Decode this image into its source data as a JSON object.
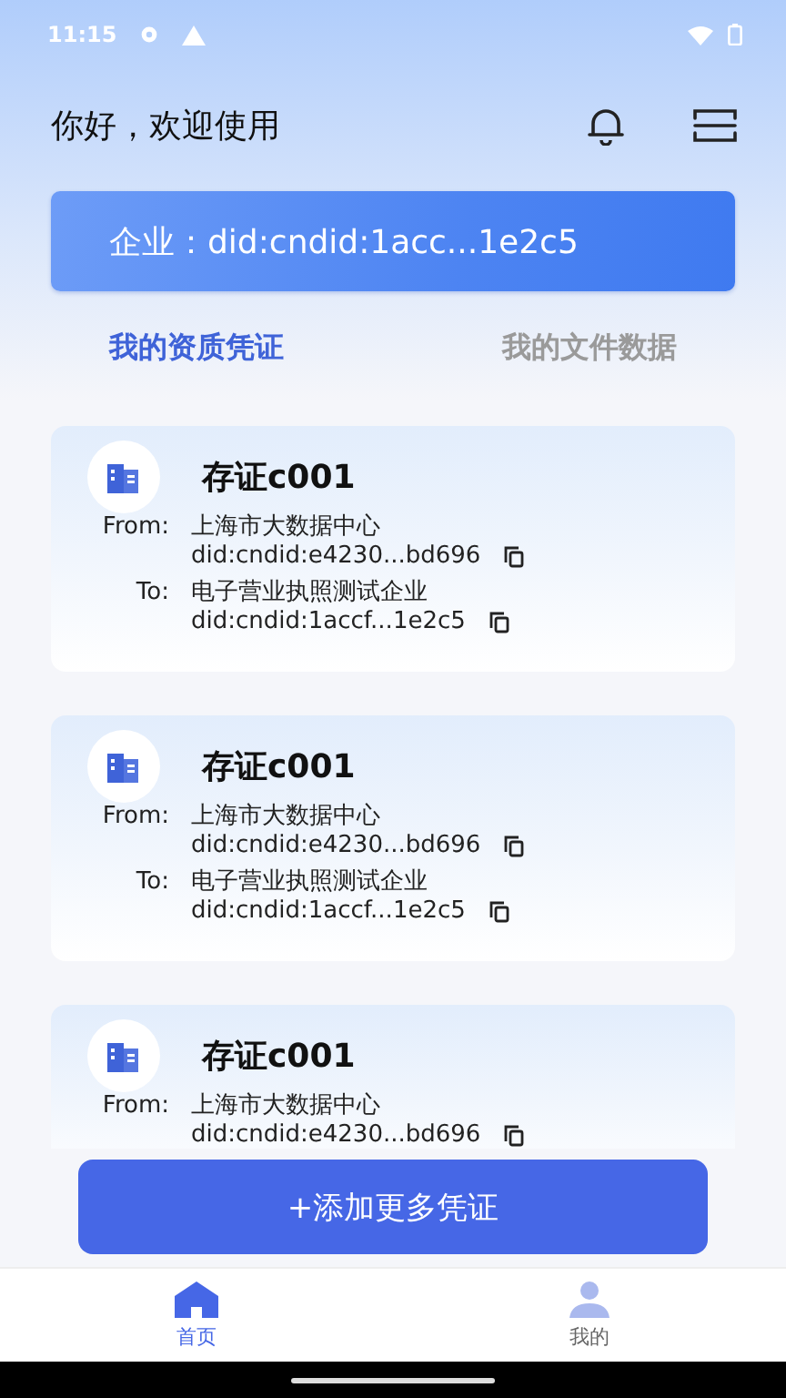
{
  "status_bar": {
    "time": "11:15"
  },
  "header": {
    "greeting": "你好，欢迎使用"
  },
  "banner": {
    "text": "企业：did:cndid:1acc...1e2c5"
  },
  "tabs": [
    {
      "label": "我的资质凭证",
      "selected": true
    },
    {
      "label": "我的文件数据",
      "selected": false
    }
  ],
  "cards": [
    {
      "title": "存证c001",
      "parties": [
        {
          "label": "From:",
          "name": "上海市大数据中心",
          "did": "did:cndid:e4230...bd696"
        },
        {
          "label": "To:",
          "name": "电子营业执照测试企业",
          "did": "did:cndid:1accf...1e2c5"
        }
      ]
    },
    {
      "title": "存证c001",
      "parties": [
        {
          "label": "From:",
          "name": "上海市大数据中心",
          "did": "did:cndid:e4230...bd696"
        },
        {
          "label": "To:",
          "name": "电子营业执照测试企业",
          "did": "did:cndid:1accf...1e2c5"
        }
      ]
    },
    {
      "title": "存证c001",
      "parties": [
        {
          "label": "From:",
          "name": "上海市大数据中心",
          "did": "did:cndid:e4230...bd696"
        }
      ]
    }
  ],
  "add_button": "+添加更多凭证",
  "nav": [
    {
      "kind": "home",
      "label": "首页",
      "selected": true
    },
    {
      "kind": "profile",
      "label": "我的",
      "selected": false
    }
  ]
}
